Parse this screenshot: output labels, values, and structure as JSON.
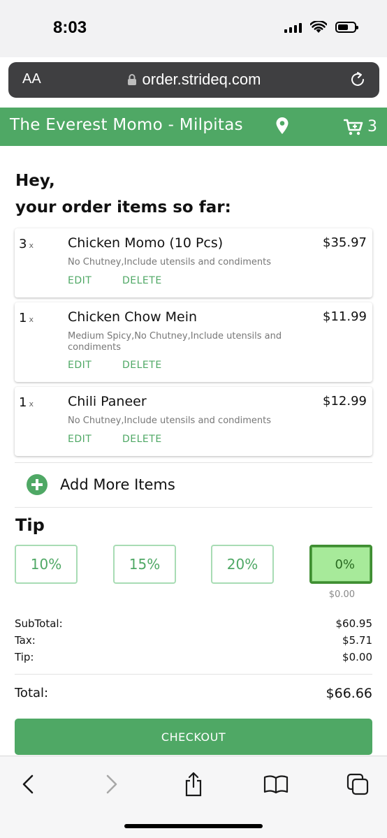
{
  "status_bar": {
    "time": "8:03"
  },
  "browser": {
    "aa_label": "AA",
    "url": "order.strideq.com"
  },
  "header": {
    "store_name": "The Everest Momo - Milpitas",
    "cart_count": "3"
  },
  "greeting": {
    "line1": "Hey,",
    "line2": "your order items so far:"
  },
  "order_items": [
    {
      "qty": "3",
      "qty_suffix": "x",
      "name": "Chicken Momo (10 Pcs)",
      "price": "$35.97",
      "notes": "No Chutney,Include utensils and condiments",
      "edit_label": "EDIT",
      "delete_label": "DELETE"
    },
    {
      "qty": "1",
      "qty_suffix": "x",
      "name": "Chicken Chow Mein",
      "price": "$11.99",
      "notes": "Medium Spicy,No Chutney,Include utensils and condiments",
      "edit_label": "EDIT",
      "delete_label": "DELETE"
    },
    {
      "qty": "1",
      "qty_suffix": "x",
      "name": "Chili Paneer",
      "price": "$12.99",
      "notes": "No Chutney,Include utensils and condiments",
      "edit_label": "EDIT",
      "delete_label": "DELETE"
    }
  ],
  "add_more_label": "Add More Items",
  "tip": {
    "title": "Tip",
    "options": [
      "10%",
      "15%",
      "20%",
      "0%"
    ],
    "selected": "0%",
    "selected_amount": "$0.00"
  },
  "summary": {
    "subtotal_label": "SubTotal:",
    "subtotal": "$60.95",
    "tax_label": "Tax:",
    "tax": "$5.71",
    "tip_label": "Tip:",
    "tip": "$0.00",
    "total_label": "Total:",
    "total": "$66.66"
  },
  "checkout_label": "CHECKOUT",
  "colors": {
    "brand_green": "#4fa865",
    "selected_tip_bg": "#a7ea9a"
  },
  "icons": [
    "lock-icon",
    "reload-icon",
    "location-pin-icon",
    "cart-icon",
    "plus-circle-icon",
    "back-icon",
    "forward-icon",
    "share-icon",
    "bookmarks-icon",
    "tabs-icon"
  ]
}
